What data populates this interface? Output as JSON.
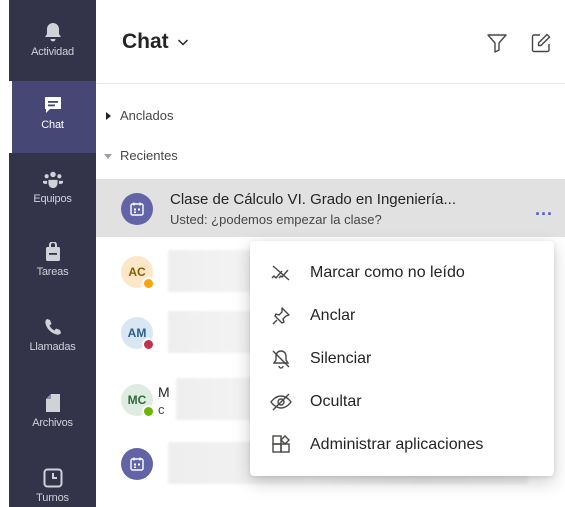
{
  "rail": {
    "items": [
      {
        "label": "Actividad",
        "icon": "bell-icon"
      },
      {
        "label": "Chat",
        "icon": "chat-icon",
        "active": true
      },
      {
        "label": "Equipos",
        "icon": "teams-icon"
      },
      {
        "label": "Tareas",
        "icon": "bag-icon"
      },
      {
        "label": "Llamadas",
        "icon": "phone-icon"
      },
      {
        "label": "Archivos",
        "icon": "file-icon"
      },
      {
        "label": "Turnos",
        "icon": "clock-icon"
      }
    ]
  },
  "header": {
    "title": "Chat",
    "filter_icon": "filter-icon",
    "compose_icon": "new-chat-icon"
  },
  "sections": {
    "pinned": "Anclados",
    "recent": "Recientes"
  },
  "chats": [
    {
      "title": "Clase de Cálculo VI. Grado en Ingeniería...",
      "subtitle": "Usted: ¿podemos empezar la clase?",
      "avatar_color": "#6264a7",
      "more": "..."
    },
    {
      "initials": "AC",
      "avatar_color": "#fde7c8",
      "initials_color": "#8a5a00",
      "status_color": "#f8a30e",
      "partial_title": "",
      "partial_sub": ""
    },
    {
      "initials": "AM",
      "avatar_color": "#d8e7f3",
      "initials_color": "#2b5f8a",
      "status_color": "#c4314b",
      "partial_title": "",
      "partial_sub": ""
    },
    {
      "initials": "MC",
      "avatar_color": "#dfece1",
      "initials_color": "#2e6b3a",
      "status_color": "#6bb700",
      "partial_title": "M",
      "partial_sub": "c"
    },
    {
      "avatar_color": "#6264a7"
    }
  ],
  "context_menu": {
    "items": [
      {
        "label": "Marcar como no leído",
        "icon": "mark-unread-icon"
      },
      {
        "label": "Anclar",
        "icon": "pin-icon"
      },
      {
        "label": "Silenciar",
        "icon": "mute-icon"
      },
      {
        "label": "Ocultar",
        "icon": "hide-icon"
      },
      {
        "label": "Administrar aplicaciones",
        "icon": "manage-apps-icon"
      }
    ]
  },
  "colors": {
    "rail_bg": "#33344a",
    "rail_active": "#464775",
    "accent": "#6264a7",
    "selected_row": "#e1e1e1"
  }
}
